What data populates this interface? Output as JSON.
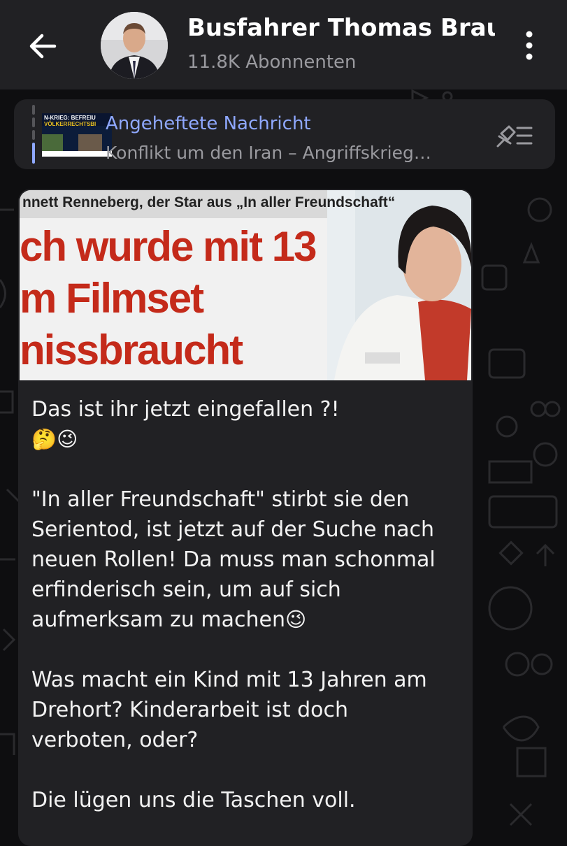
{
  "header": {
    "channel_name": "Busfahrer Thomas Braun",
    "subscribers": "11.8K Abonnenten",
    "back_icon": "arrow-left-icon",
    "menu_icon": "vertical-dots-icon"
  },
  "pinned": {
    "title": "Angeheftete Nachricht",
    "preview": "Konflikt um den Iran – Angriffskrieg…",
    "thumbnail_lines": [
      "N-KRIEG: BEFREIU",
      "VÖLKERRECHTSBI"
    ],
    "unpin_icon": "unpin-list-icon"
  },
  "post_image": {
    "kicker": "nnett Renneberg, der Star aus „In aller Freundschaft“",
    "headline_lines": [
      "ch wurde mit 13",
      "m Filmset",
      "nissbraucht"
    ]
  },
  "message": {
    "line1": "Das ist ihr jetzt eingefallen ?!",
    "line1_emoji": "🤔😉",
    "para2": "\"In aller Freundschaft\" stirbt sie den Serientod, ist jetzt auf der Suche nach neuen Rollen! Da muss man schonmal erfinderisch sein, um auf sich aufmerksam zu machen",
    "para2_emoji": "😉",
    "para3": "Was macht ein Kind mit 13 Jahren am Drehort? Kinderarbeit ist doch verboten, oder?",
    "para4": "Die lügen uns die Taschen voll."
  },
  "colors": {
    "header_bg": "#212124",
    "accent": "#8fa8ff",
    "headline_red": "#c42a1a",
    "bubble_bg": "#212124"
  }
}
